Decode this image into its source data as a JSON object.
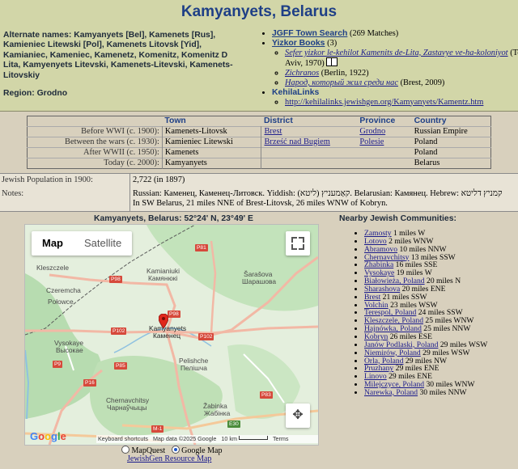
{
  "page_title": "Kamyanyets, Belarus",
  "alt_names_label": "Alternate names:",
  "alt_names_text": "Kamyanyets [Bel], Kamenets [Rus], Kamieniec Litewski [Pol], Kamenets Litovsk [Yid], Kamianiec, Kameniec, Kamenetz, Komenitz, Komenitz D Lita, Kamyenyets Litevski, Kamenets-Litevski, Kamenets-Litovskiy",
  "region_label": "Region:",
  "region_value": "Grodno",
  "resources": {
    "jgff_label": "JGFF Town Search",
    "jgff_count": "(269 Matches)",
    "yizkor_label": "Yizkor Books",
    "yizkor_count": "(3)",
    "books": [
      {
        "title": "Sefer yizkor le-kehilot Kamenits de-Lita, Zastavye ve-ha-koloniyot",
        "info": "(Tel Aviv, 1970)"
      },
      {
        "title": "Zichranos",
        "info": "(Berlin, 1922)"
      },
      {
        "title": "Народ, который жил среди нас",
        "info": "(Brest, 2009)"
      }
    ],
    "kehila_label": "KehilaLinks",
    "kehila_url": "http://kehilalinks.jewishgen.org/Kamyanyets/Kamentz.htm"
  },
  "towns_table": {
    "headers": [
      "Town",
      "District",
      "Province",
      "Country"
    ],
    "rows": [
      {
        "period": "Before WWI (c. 1900):",
        "town": "Kamenets-Litovsk",
        "district": "Brest",
        "province": "Grodno",
        "country": "Russian Empire"
      },
      {
        "period": "Between the wars (c. 1930):",
        "town": "Kamieniec Litewski",
        "district": "Brześć nad Bugiem",
        "province": "Polesie",
        "country": "Poland"
      },
      {
        "period": "After WWII (c. 1950):",
        "town": "Kamenets",
        "district": "",
        "province": "",
        "country": "Poland"
      },
      {
        "period": "Today (c. 2000):",
        "town": "Kamyanyets",
        "district": "",
        "province": "",
        "country": "Belarus"
      }
    ]
  },
  "population": {
    "label": "Jewish Population in 1900:",
    "value": "2,722 (in 1897)"
  },
  "notes": {
    "label": "Notes:",
    "line1": "Russian: Каменец, Каменец-Литовск. Yiddish: קאַמעניץ (ליטא). Belarusian: Камянец. Hebrew: קמניץ דליטא",
    "line2": "In SW Belarus, 21 miles NNE of Brest-Litovsk, 26 miles WNW of Kobryn."
  },
  "map": {
    "caption": "Kamyanyets, Belarus: 52°24' N, 23°49' E",
    "btn_map": "Map",
    "btn_satellite": "Satellite",
    "places": [
      "Kleszczele",
      "Czeremcha",
      "Połowce",
      "Kamianiuki",
      "Камянюкі",
      "Šarašova",
      "Шарашова",
      "Kamyanyets",
      "Каменец",
      "Vysokaye",
      "Высокае",
      "Pelishche",
      "Пелішча",
      "Chernavchitsy",
      "Чарнаўчыцы",
      "Žabinka",
      "Жабінка"
    ],
    "roads": [
      "P81",
      "P98",
      "P98",
      "P102",
      "P102",
      "P16",
      "P85",
      "P9",
      "P83",
      "M-1",
      "E30"
    ],
    "google": "Google",
    "attr_shortcuts": "Keyboard shortcuts",
    "attr_data": "Map data ©2025 Google",
    "attr_scale": "10 km",
    "attr_terms": "Terms",
    "radio_mapquest": "MapQuest",
    "radio_google": "Google Map",
    "resource_link": "JewishGen Resource Map",
    "accent_color": "#d6493b"
  },
  "nearby": {
    "title": "Nearby Jewish Communities:",
    "items": [
      {
        "name": "Zamosty",
        "dist": "1 miles W"
      },
      {
        "name": "Lotovo",
        "dist": "2 miles WNW"
      },
      {
        "name": "Abramovo",
        "dist": "10 miles NNW"
      },
      {
        "name": "Chernavchitsy",
        "dist": "13 miles SSW"
      },
      {
        "name": "Zhabinka",
        "dist": "16 miles SSE"
      },
      {
        "name": "Vysokaye",
        "dist": "19 miles W"
      },
      {
        "name": "Białowieża, Poland",
        "dist": "20 miles N"
      },
      {
        "name": "Sharashova",
        "dist": "20 miles ENE"
      },
      {
        "name": "Brest",
        "dist": "21 miles SSW"
      },
      {
        "name": "Volchin",
        "dist": "23 miles WSW"
      },
      {
        "name": "Terespol, Poland",
        "dist": "24 miles SSW"
      },
      {
        "name": "Kleszczele, Poland",
        "dist": "25 miles WNW"
      },
      {
        "name": "Hajnówka, Poland",
        "dist": "25 miles NNW"
      },
      {
        "name": "Kobryn",
        "dist": "26 miles ESE"
      },
      {
        "name": "Janów Podlaski, Poland",
        "dist": "29 miles WSW"
      },
      {
        "name": "Niemirów, Poland",
        "dist": "29 miles WSW"
      },
      {
        "name": "Orla, Poland",
        "dist": "29 miles NW"
      },
      {
        "name": "Pruzhany",
        "dist": "29 miles ENE"
      },
      {
        "name": "Linovo",
        "dist": "29 miles ENE"
      },
      {
        "name": "Milejczyce, Poland",
        "dist": "30 miles WNW"
      },
      {
        "name": "Narewka, Poland",
        "dist": "30 miles NNW"
      }
    ]
  }
}
